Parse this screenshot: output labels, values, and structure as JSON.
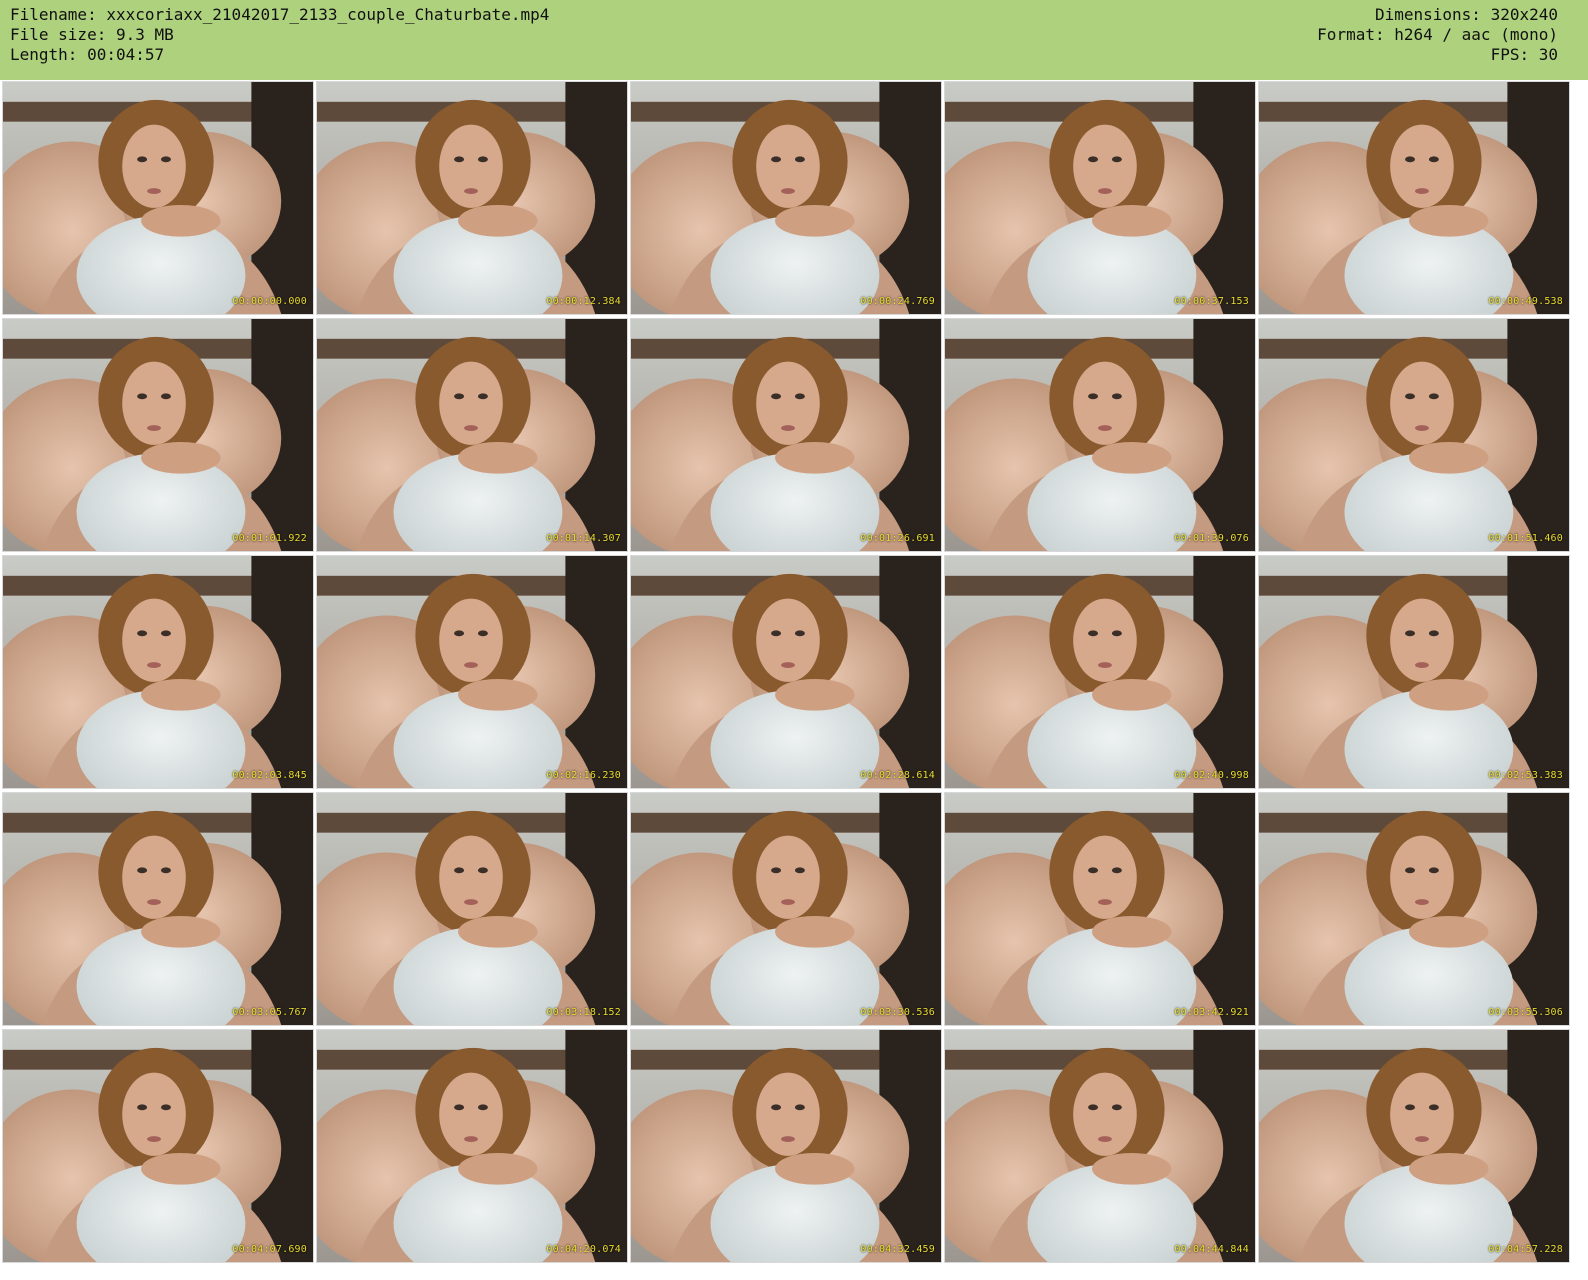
{
  "header": {
    "filename": "Filename: xxxcoriaxx_21042017_2133_couple_Chaturbate.mp4",
    "filesize": "File size: 9.3 MB",
    "length": "Length: 00:04:57",
    "dimensions": "Dimensions: 320x240",
    "format": "Format: h264 / aac (mono)",
    "fps": "FPS: 30"
  },
  "thumbnails": [
    {
      "timestamp": "00:00:00.000"
    },
    {
      "timestamp": "00:00:12.384"
    },
    {
      "timestamp": "00:00:24.769"
    },
    {
      "timestamp": "00:00:37.153"
    },
    {
      "timestamp": "00:00:49.538"
    },
    {
      "timestamp": "00:01:01.922"
    },
    {
      "timestamp": "00:01:14.307"
    },
    {
      "timestamp": "00:01:26.691"
    },
    {
      "timestamp": "00:01:39.076"
    },
    {
      "timestamp": "00:01:51.460"
    },
    {
      "timestamp": "00:02:03.845"
    },
    {
      "timestamp": "00:02:16.230"
    },
    {
      "timestamp": "00:02:28.614"
    },
    {
      "timestamp": "00:02:40.998"
    },
    {
      "timestamp": "00:02:53.383"
    },
    {
      "timestamp": "00:03:05.767"
    },
    {
      "timestamp": "00:03:18.152"
    },
    {
      "timestamp": "00:03:30.536"
    },
    {
      "timestamp": "00:03:42.921"
    },
    {
      "timestamp": "00:03:55.306"
    },
    {
      "timestamp": "00:04:07.690"
    },
    {
      "timestamp": "00:04:20.074"
    },
    {
      "timestamp": "00:04:32.459"
    },
    {
      "timestamp": "00:04:44.844"
    },
    {
      "timestamp": "00:04:57.228"
    }
  ],
  "colors": {
    "header_bg": "#aed17d",
    "timestamp": "#e7dc2d"
  }
}
